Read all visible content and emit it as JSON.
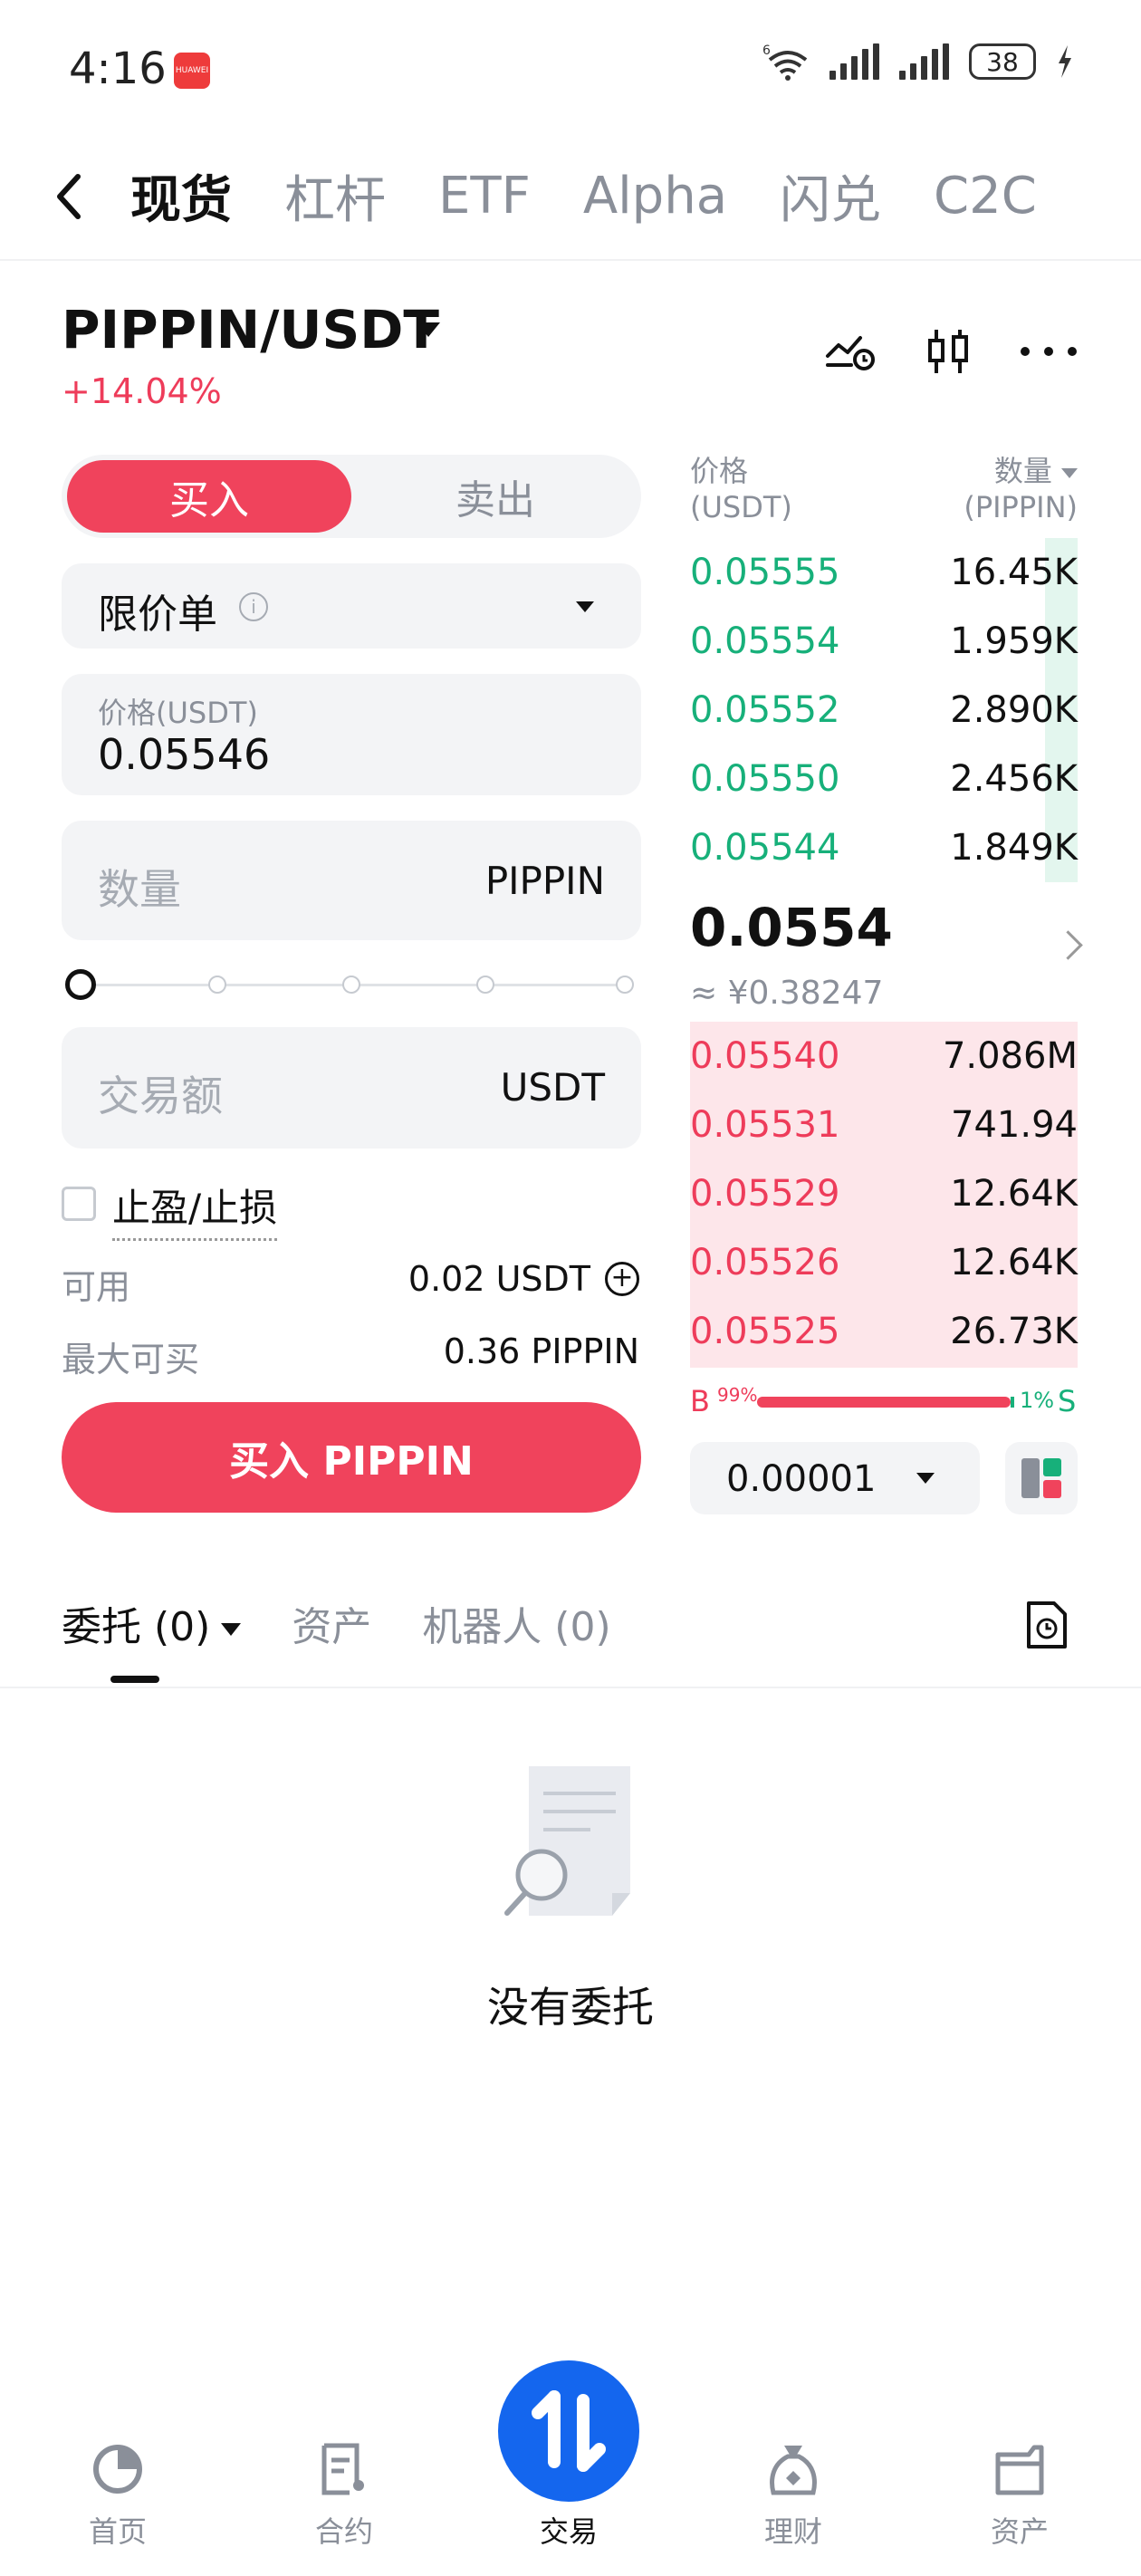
{
  "status": {
    "time": "4:16",
    "badge": "HUAWEI",
    "wifi_label": "6",
    "battery": "38"
  },
  "top_tabs": [
    "现货",
    "杠杆",
    "ETF",
    "Alpha",
    "闪兑",
    "C2C"
  ],
  "pair": {
    "name": "PIPPIN/USDT",
    "change": "+14.04%"
  },
  "trade_form": {
    "buy_tab": "买入",
    "sell_tab": "卖出",
    "order_type": "限价单",
    "price_label": "价格(USDT)",
    "price_value": "0.05546",
    "qty_placeholder": "数量",
    "qty_unit": "PIPPIN",
    "amount_placeholder": "交易额",
    "amount_unit": "USDT",
    "tpsl_label": "止盈/止损",
    "available_label": "可用",
    "available_value": "0.02 USDT",
    "max_buy_label": "最大可买",
    "max_buy_value": "0.36 PIPPIN",
    "submit_label": "买入 PIPPIN"
  },
  "orderbook": {
    "price_header": "价格",
    "price_unit": "(USDT)",
    "qty_header": "数量",
    "qty_unit": "(PIPPIN)",
    "asks": [
      {
        "price": "0.05555",
        "qty": "16.45K"
      },
      {
        "price": "0.05554",
        "qty": "1.959K"
      },
      {
        "price": "0.05552",
        "qty": "2.890K"
      },
      {
        "price": "0.05550",
        "qty": "2.456K"
      },
      {
        "price": "0.05544",
        "qty": "1.849K"
      }
    ],
    "last_price": "0.0554",
    "last_price_fiat": "≈ ¥0.38247",
    "bids": [
      {
        "price": "0.05540",
        "qty": "7.086M"
      },
      {
        "price": "0.05531",
        "qty": "741.94"
      },
      {
        "price": "0.05529",
        "qty": "12.64K"
      },
      {
        "price": "0.05526",
        "qty": "12.64K"
      },
      {
        "price": "0.05525",
        "qty": "26.73K"
      }
    ],
    "ratio": {
      "b_label": "B",
      "b_pct": "99%",
      "s_label": "S",
      "s_pct": "1%"
    },
    "precision": "0.00001"
  },
  "orders_tabs": {
    "entrust": "委托 (0)",
    "assets": "资产",
    "bots": "机器人 (0)"
  },
  "empty_text": "没有委托",
  "bottom_nav": [
    "首页",
    "合约",
    "交易",
    "理财",
    "资产"
  ],
  "colors": {
    "buy": "#f0435c",
    "ask": "#17b07a",
    "accent": "#1466ee"
  }
}
